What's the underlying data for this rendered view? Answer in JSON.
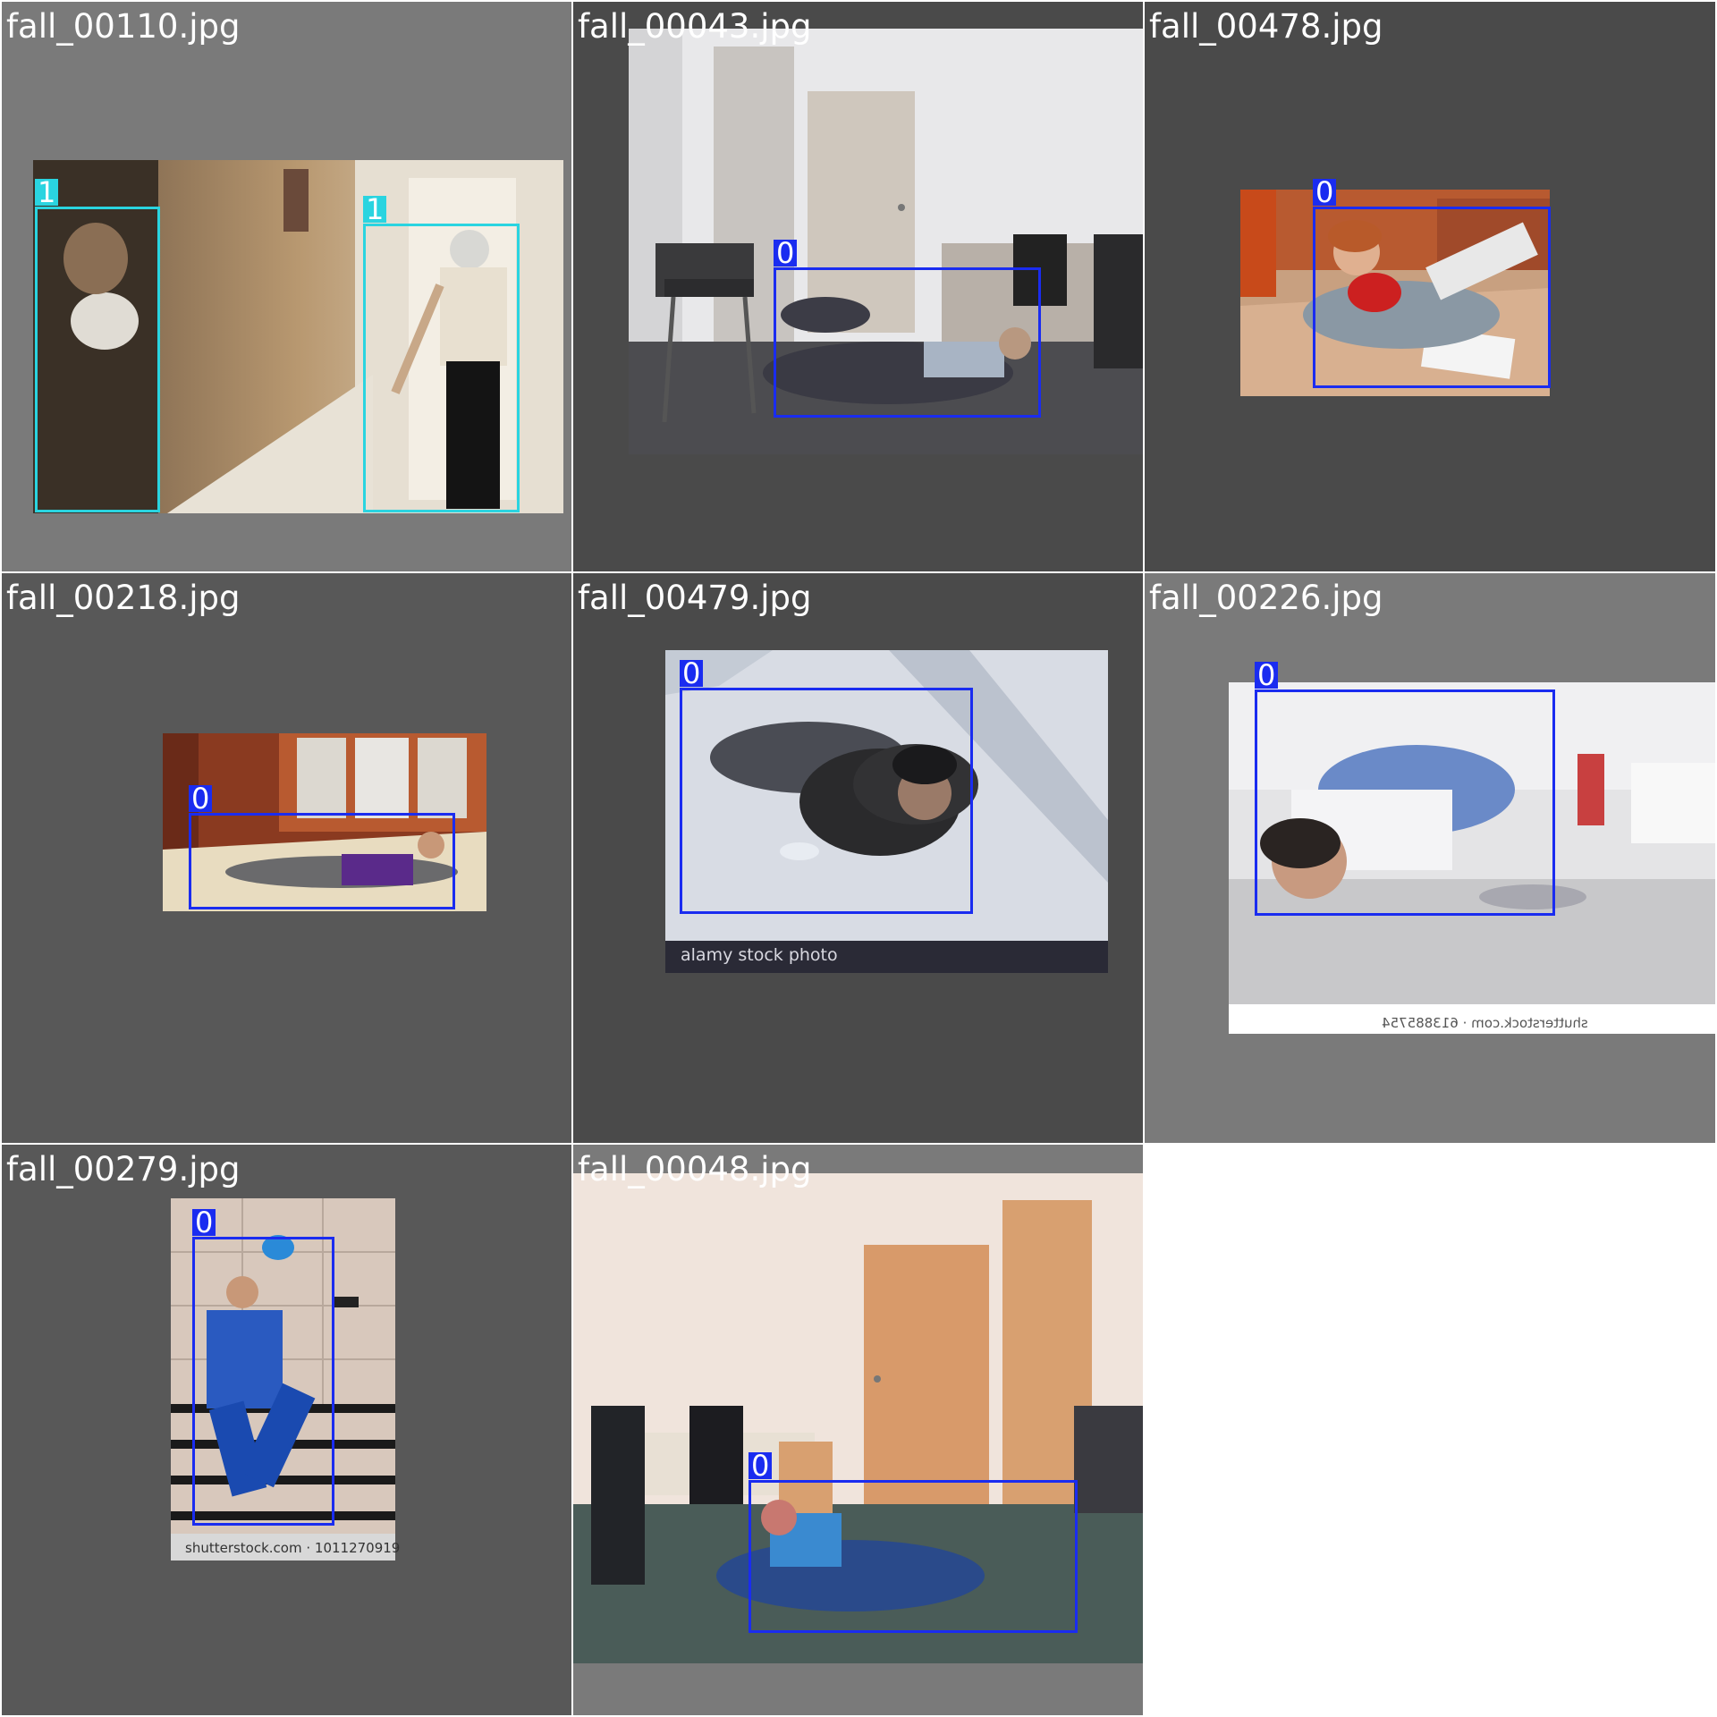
{
  "colors": {
    "class_0": "#1a2cf0",
    "class_1": "#2ad4e0"
  },
  "tiles": [
    {
      "filename": "fall_00110.jpg",
      "detections": [
        {
          "label": "1"
        },
        {
          "label": "1"
        }
      ]
    },
    {
      "filename": "fall_00043.jpg",
      "detections": [
        {
          "label": "0"
        }
      ]
    },
    {
      "filename": "fall_00478.jpg",
      "detections": [
        {
          "label": "0"
        }
      ]
    },
    {
      "filename": "fall_00218.jpg",
      "detections": [
        {
          "label": "0"
        }
      ]
    },
    {
      "filename": "fall_00479.jpg",
      "detections": [
        {
          "label": "0"
        }
      ],
      "watermark": "alamy stock photo"
    },
    {
      "filename": "fall_00226.jpg",
      "detections": [
        {
          "label": "0"
        }
      ],
      "watermark": "shutterstock.com · 613885754"
    },
    {
      "filename": "fall_00279.jpg",
      "detections": [
        {
          "label": "0"
        }
      ],
      "watermark": "shutterstock.com · 1011270919"
    },
    {
      "filename": "fall_00048.jpg",
      "detections": [
        {
          "label": "0"
        }
      ]
    }
  ]
}
